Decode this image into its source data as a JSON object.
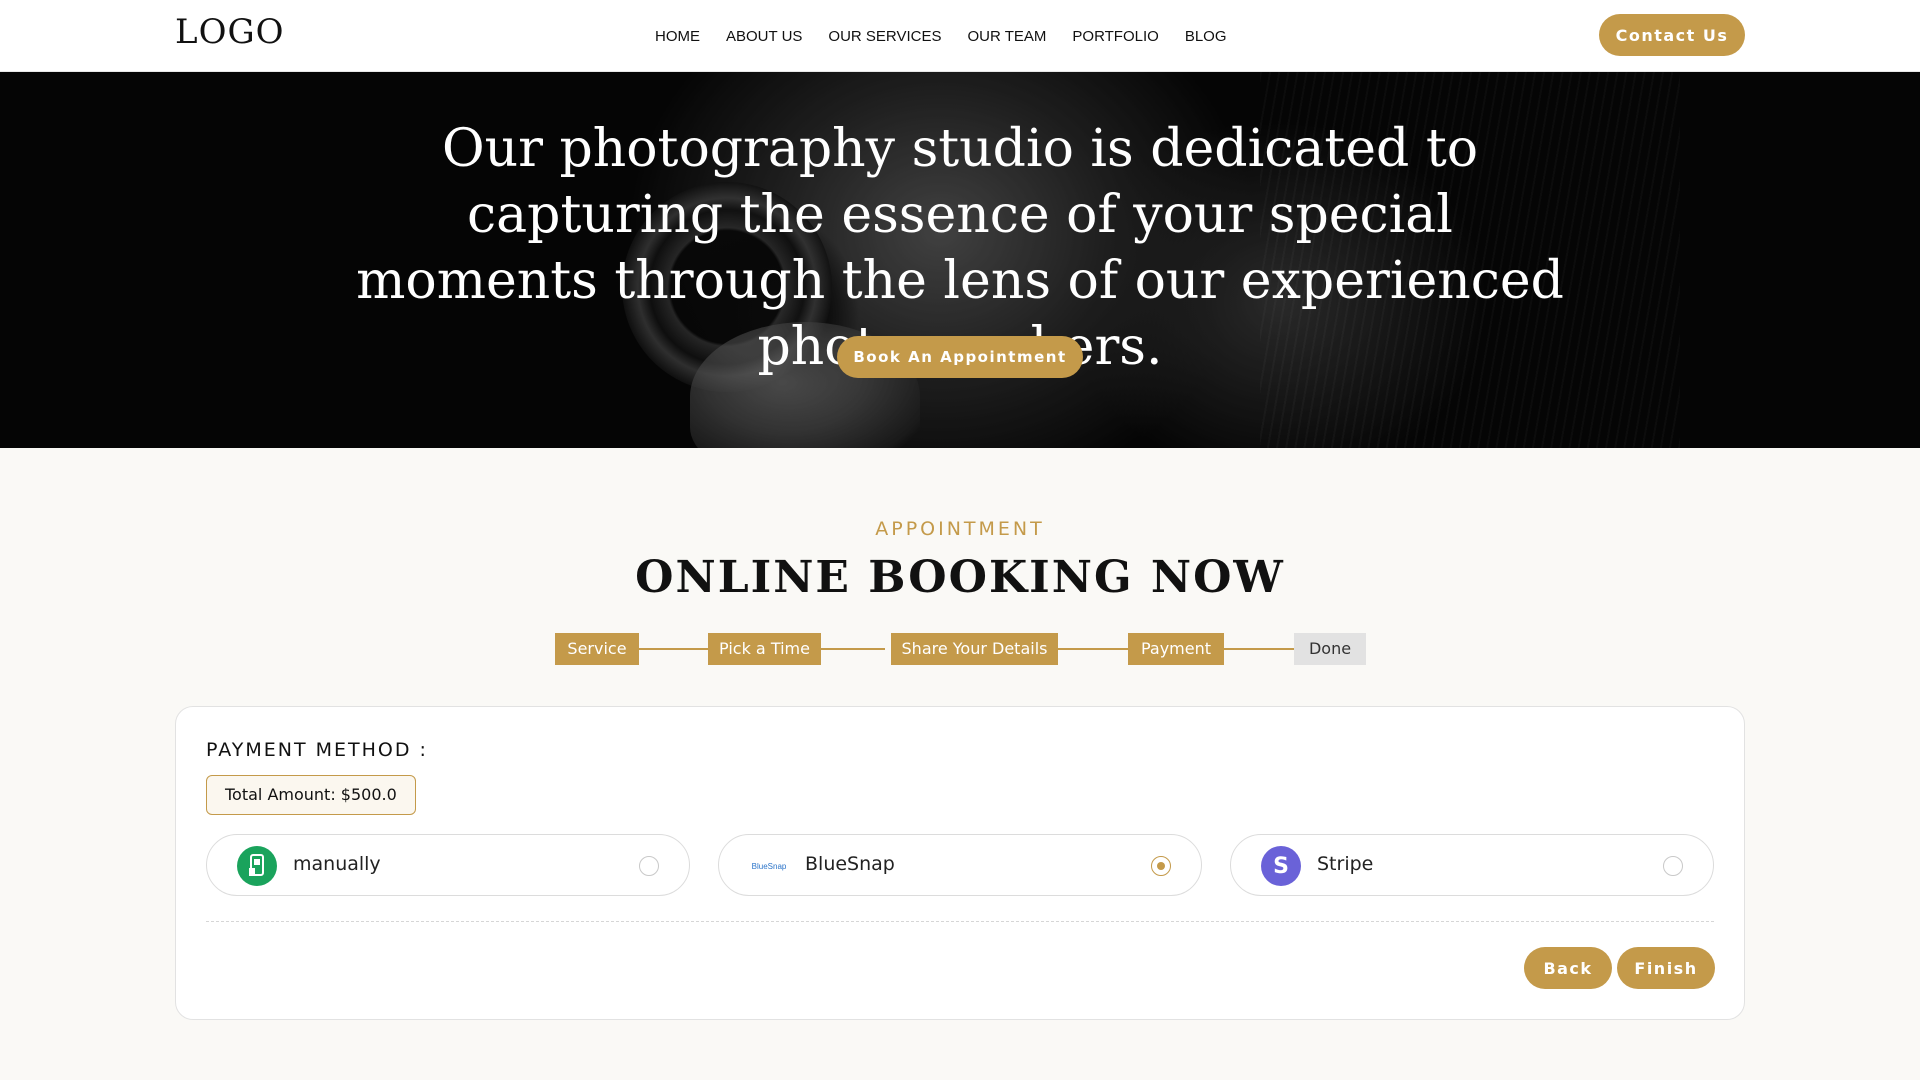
{
  "header": {
    "logo": "LOGO",
    "nav": [
      "HOME",
      "ABOUT US",
      "OUR SERVICES",
      "OUR TEAM",
      "PORTFOLIO",
      "BLOG"
    ],
    "contact_label": "Contact Us"
  },
  "hero": {
    "title": "Our photography studio is dedicated to capturing the essence of your special moments through the lens of our experienced photographers.",
    "cta_label": "Book An Appointment"
  },
  "booking": {
    "eyebrow": "APPOINTMENT",
    "title": "ONLINE BOOKING NOW",
    "steps": [
      {
        "label": "Service",
        "state": "complete"
      },
      {
        "label": "Pick a Time",
        "state": "complete"
      },
      {
        "label": "Share Your Details",
        "state": "complete"
      },
      {
        "label": "Payment",
        "state": "complete"
      },
      {
        "label": "Done",
        "state": "pending"
      }
    ],
    "payment": {
      "heading": "PAYMENT METHOD :",
      "total": "Total Amount: $500.0",
      "methods": [
        {
          "label": "manually",
          "icon": "manual-payment-icon",
          "selected": false
        },
        {
          "label": "BlueSnap",
          "icon": "bluesnap-logo-icon",
          "icon_text": "BlueSnap",
          "selected": true
        },
        {
          "label": "Stripe",
          "icon": "stripe-icon",
          "icon_text": "S",
          "selected": false
        }
      ],
      "back_label": "Back",
      "finish_label": "Finish"
    }
  },
  "colors": {
    "accent": "#c49a4a",
    "step_pending": "#e2e2e2",
    "manual_icon_bg": "#1aa35c",
    "stripe_icon_bg": "#6a62d8"
  }
}
